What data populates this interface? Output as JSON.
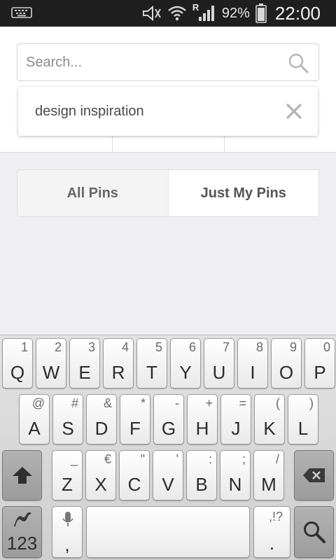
{
  "status_bar": {
    "battery_percent": "92%",
    "time": "22:00",
    "network_roaming": "R",
    "icons": [
      "keyboard-notification-icon",
      "mute-icon",
      "wifi-icon",
      "signal-icon",
      "battery-icon"
    ]
  },
  "search": {
    "placeholder": "Search...",
    "value": "",
    "suggestion": "design inspiration"
  },
  "filter": {
    "tabs": [
      {
        "label": "All Pins",
        "selected": true
      },
      {
        "label": "Just My Pins",
        "selected": false
      }
    ]
  },
  "keyboard": {
    "row1": [
      {
        "pri": "Q",
        "sec": "1"
      },
      {
        "pri": "W",
        "sec": "2"
      },
      {
        "pri": "E",
        "sec": "3"
      },
      {
        "pri": "R",
        "sec": "4"
      },
      {
        "pri": "T",
        "sec": "5"
      },
      {
        "pri": "Y",
        "sec": "6"
      },
      {
        "pri": "U",
        "sec": "7"
      },
      {
        "pri": "I",
        "sec": "8"
      },
      {
        "pri": "O",
        "sec": "9"
      },
      {
        "pri": "P",
        "sec": "0"
      }
    ],
    "row2": [
      {
        "pri": "A",
        "sec": "@"
      },
      {
        "pri": "S",
        "sec": "#"
      },
      {
        "pri": "D",
        "sec": "&"
      },
      {
        "pri": "F",
        "sec": "*"
      },
      {
        "pri": "G",
        "sec": "-"
      },
      {
        "pri": "H",
        "sec": "+"
      },
      {
        "pri": "J",
        "sec": "="
      },
      {
        "pri": "K",
        "sec": "("
      },
      {
        "pri": "L",
        "sec": ")"
      }
    ],
    "row3": [
      {
        "pri": "Z",
        "sec": "_"
      },
      {
        "pri": "X",
        "sec": "€"
      },
      {
        "pri": "C",
        "sec": "\""
      },
      {
        "pri": "V",
        "sec": "'"
      },
      {
        "pri": "B",
        "sec": ":"
      },
      {
        "pri": "N",
        "sec": ";"
      },
      {
        "pri": "M",
        "sec": "/"
      }
    ],
    "numbers_label": "123",
    "comma_label": ",",
    "period_label": ".",
    "punct_label": ",!?",
    "icons": {
      "shift": "shift-icon",
      "backspace": "backspace-icon",
      "mic": "mic-icon",
      "search": "search-icon",
      "swiftkey": "swiftkey-logo-icon"
    }
  }
}
